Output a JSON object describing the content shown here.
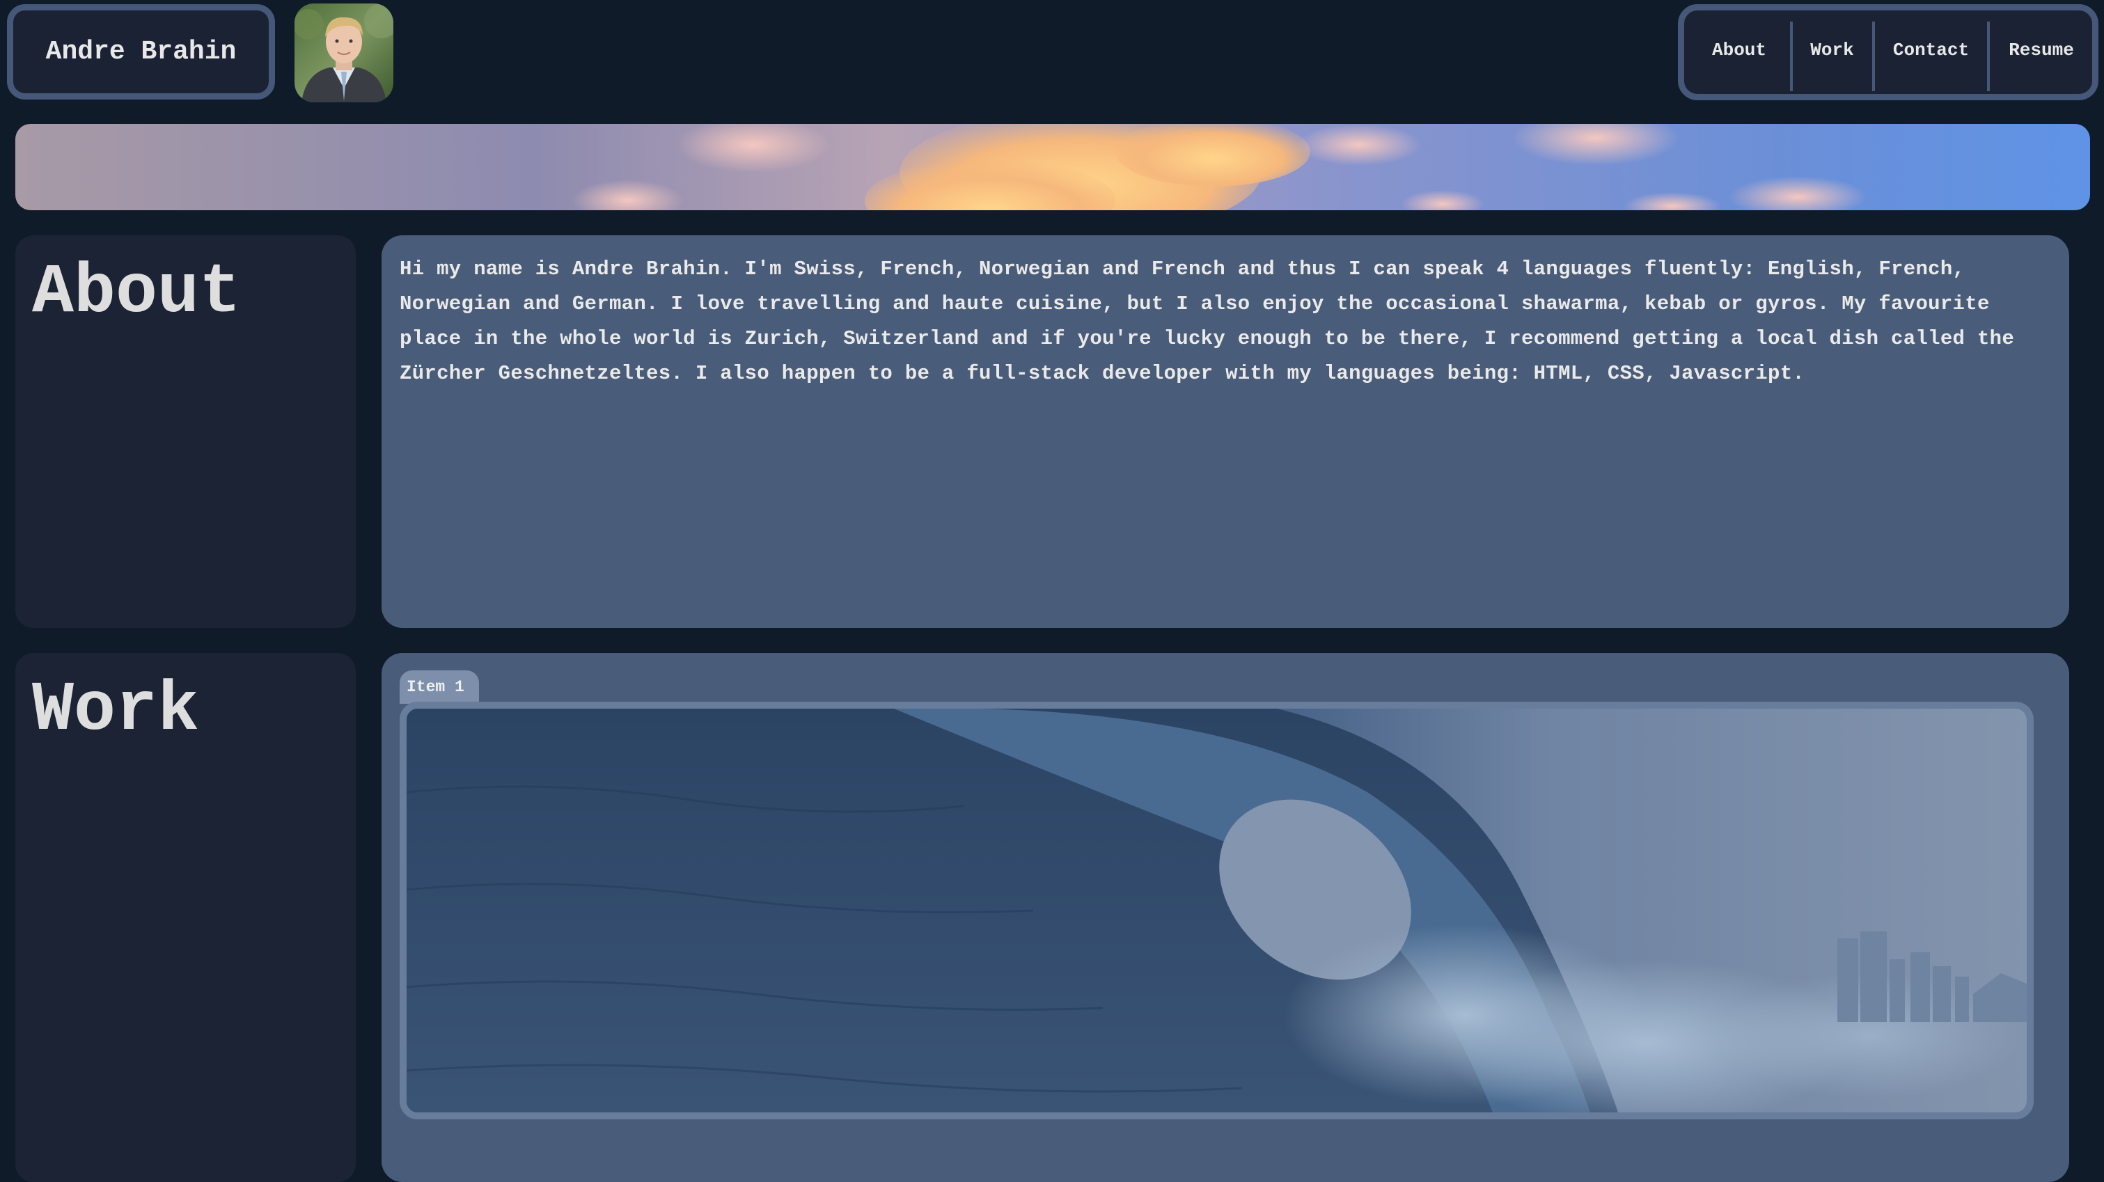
{
  "header": {
    "name": "Andre Brahin",
    "nav": [
      "About",
      "Work",
      "Contact",
      "Resume"
    ]
  },
  "about": {
    "title": "About",
    "text": "Hi my name is Andre Brahin. I'm Swiss, French, Norwegian and French and thus I can speak 4 languages fluently: English, French, Norwegian and German. I love travelling and haute cuisine, but I also enjoy the occasional shawarma, kebab or gyros. My favourite place in the whole world is Zurich, Switzerland and if you're lucky enough to be there, I recommend getting a local dish called the Zürcher Geschnetzeltes. I also happen to be a full-stack developer with my languages being: HTML, CSS, Javascript."
  },
  "work": {
    "title": "Work",
    "items": [
      {
        "label": "Item 1"
      }
    ]
  },
  "colors": {
    "background": "#0f1b29",
    "panel_dark": "#1b2334",
    "panel_light": "#495c79",
    "border": "#46587a",
    "text": "#e8e8e8"
  },
  "icons": {
    "avatar": "profile-photo",
    "banner": "sunset-clouds-image",
    "work_image": "ocean-wave-image"
  }
}
